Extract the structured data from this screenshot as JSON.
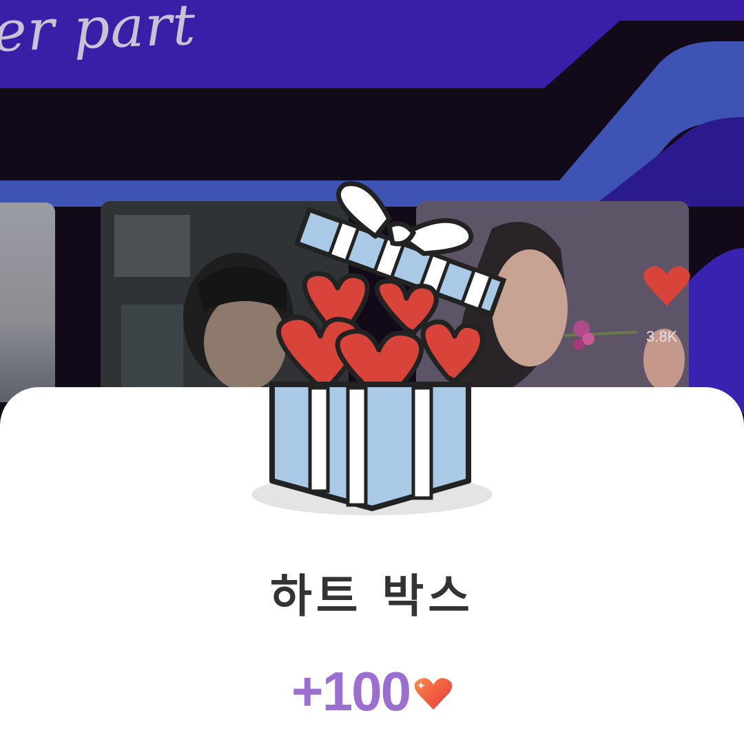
{
  "background": {
    "banner_title": "er part",
    "reaction_count": "3.8K",
    "colors": {
      "banner_blue": "#3a1ea8",
      "band_blue": "#3e53b3",
      "dark": "#120a18"
    }
  },
  "popup": {
    "icon": "heart-gift-box-icon",
    "title": "하트 박스",
    "reward": "+100",
    "reward_icon": "heart-icon",
    "colors": {
      "title": "#333333",
      "reward": "#9b6fd0",
      "heart": "#e24a3a",
      "box": "#aac9e6"
    }
  }
}
